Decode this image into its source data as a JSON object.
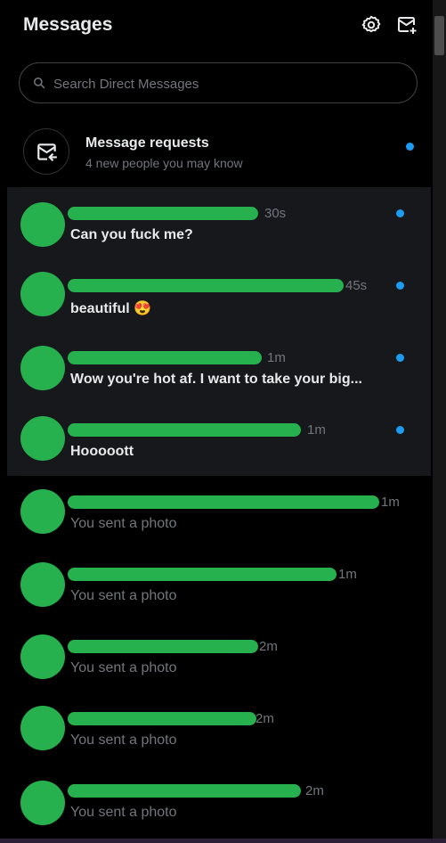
{
  "header": {
    "title": "Messages",
    "settings_icon": "gear-icon",
    "compose_icon": "new-message-icon"
  },
  "search": {
    "placeholder": "Search Direct Messages"
  },
  "requests": {
    "title": "Message requests",
    "subtitle": "4 new people you may know",
    "icon": "message-request-icon",
    "unread": true
  },
  "conversations": [
    {
      "time": "30s",
      "preview": "Can you fuck me?",
      "unread": true
    },
    {
      "time": "45s",
      "preview": "beautiful 😍",
      "unread": true
    },
    {
      "time": "1m",
      "preview": "Wow you're hot af. I want to take your big...",
      "unread": true
    },
    {
      "time": "1m",
      "preview": "Hooooott",
      "unread": true
    },
    {
      "time": "1m",
      "preview": "You sent a photo",
      "unread": false
    },
    {
      "time": "1m",
      "preview": "You sent a photo",
      "unread": false
    },
    {
      "time": "2m",
      "preview": "You sent a photo",
      "unread": false
    },
    {
      "time": "2m",
      "preview": "You sent a photo",
      "unread": false
    },
    {
      "time": "2m",
      "preview": "You sent a photo",
      "unread": false
    }
  ],
  "colors": {
    "accent": "#1d9bf0",
    "redaction": "#27b04e",
    "background": "#000000",
    "unread_row": "#16181c"
  }
}
